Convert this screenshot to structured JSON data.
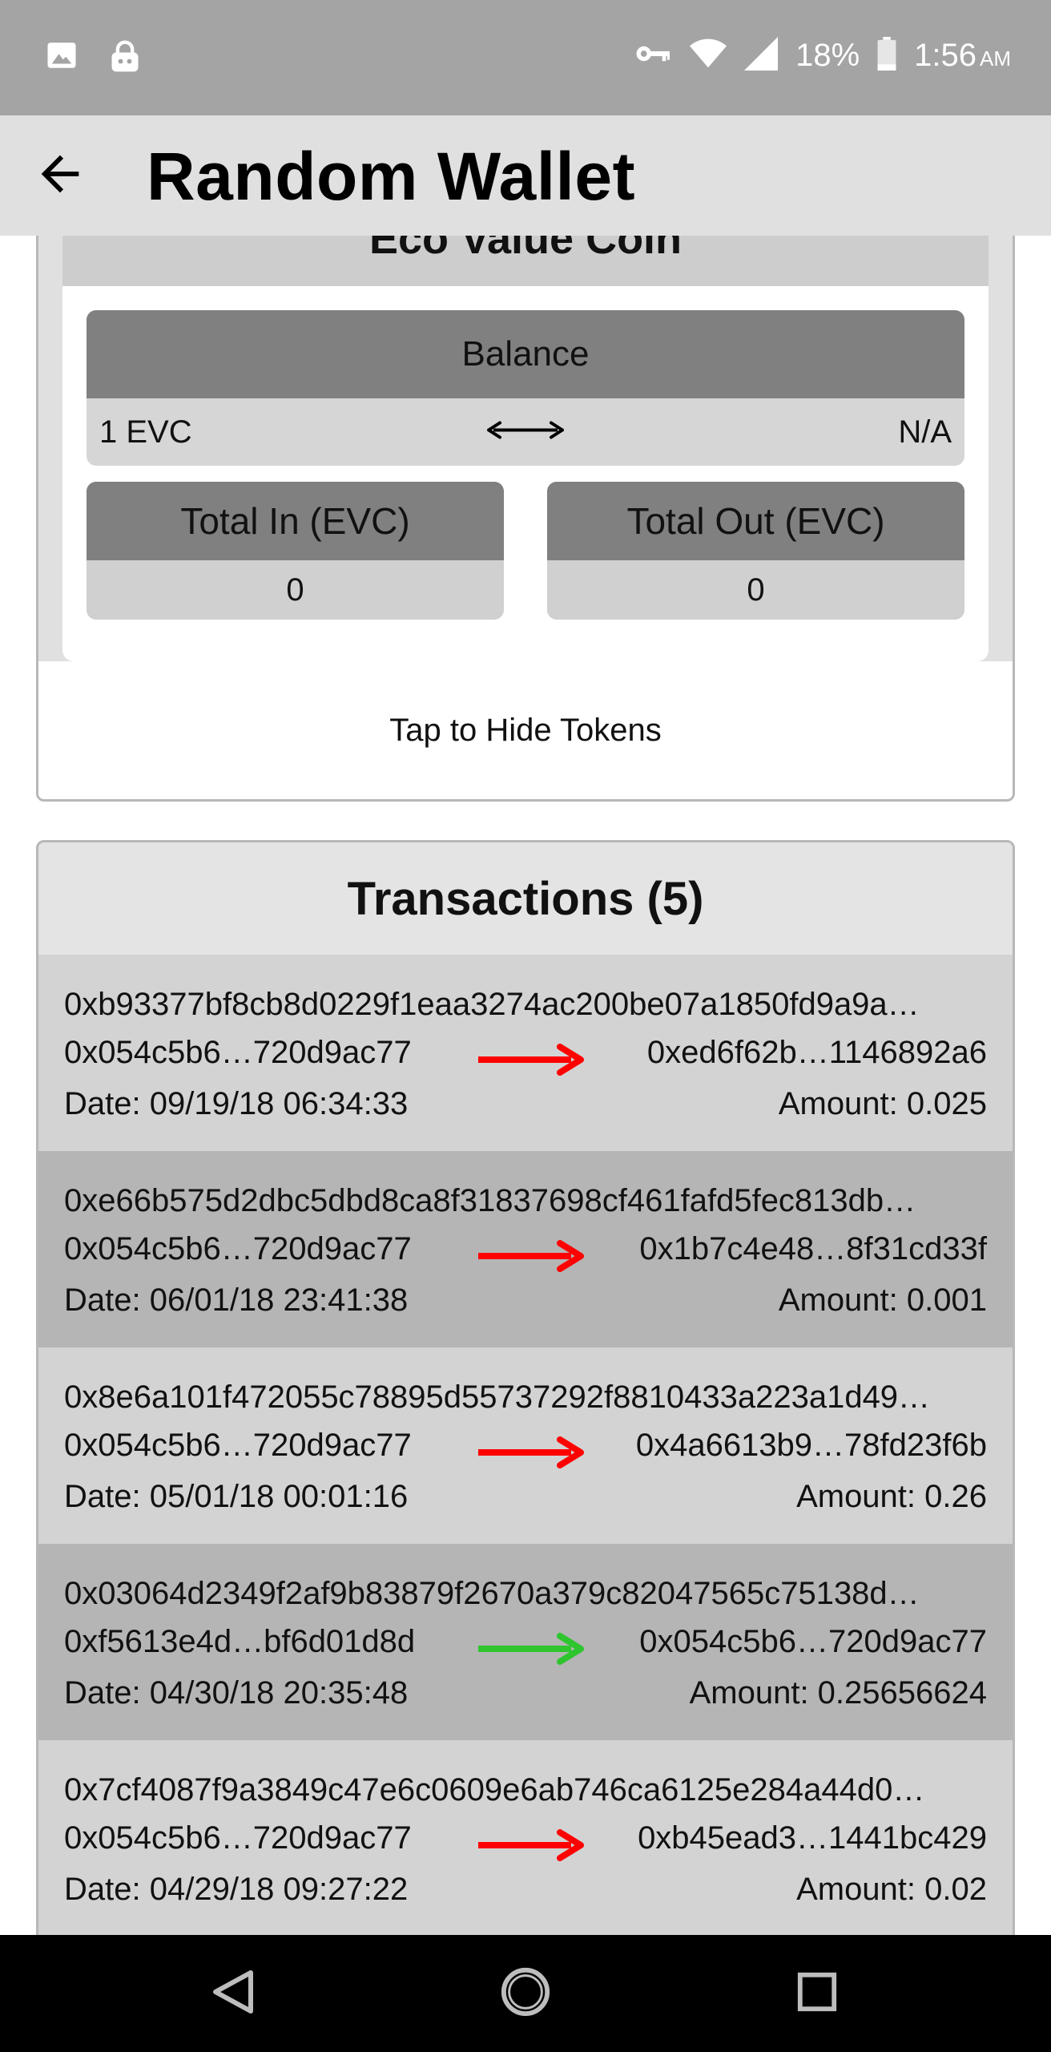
{
  "status_bar": {
    "battery": "18%",
    "time": "1:56",
    "ampm": "AM",
    "icons": [
      "image-icon",
      "vpn-lock-icon",
      "key-icon",
      "wifi-icon",
      "signal-icon",
      "battery-icon"
    ]
  },
  "app_bar": {
    "title": "Random Wallet",
    "back_icon": "arrow-back-icon"
  },
  "token": {
    "name": "Eco Value Coin",
    "balance_label": "Balance",
    "balance_value": "1 EVC",
    "balance_fiat": "N/A",
    "total_in_label": "Total In (EVC)",
    "total_in_value": "0",
    "total_out_label": "Total Out (EVC)",
    "total_out_value": "0",
    "hide_label": "Tap to Hide Tokens"
  },
  "transactions": {
    "header": "Transactions (5)",
    "items": [
      {
        "hash": "0xb93377bf8cb8d0229f1eaa3274ac200be07a1850fd9a9a…",
        "from": "0x054c5b6…720d9ac77",
        "to": "0xed6f62b…1146892a6",
        "date": "Date: 09/19/18 06:34:33",
        "amount": "Amount: 0.025",
        "direction": "out"
      },
      {
        "hash": "0xe66b575d2dbc5dbd8ca8f31837698cf461fafd5fec813db…",
        "from": "0x054c5b6…720d9ac77",
        "to": "0x1b7c4e48…8f31cd33f",
        "date": "Date: 06/01/18 23:41:38",
        "amount": "Amount: 0.001",
        "direction": "out"
      },
      {
        "hash": "0x8e6a101f472055c78895d55737292f8810433a223a1d49…",
        "from": "0x054c5b6…720d9ac77",
        "to": "0x4a6613b9…78fd23f6b",
        "date": "Date: 05/01/18 00:01:16",
        "amount": "Amount: 0.26",
        "direction": "out"
      },
      {
        "hash": "0x03064d2349f2af9b83879f2670a379c82047565c75138d…",
        "from": "0xf5613e4d…bf6d01d8d",
        "to": "0x054c5b6…720d9ac77",
        "date": "Date: 04/30/18 20:35:48",
        "amount": "Amount: 0.25656624",
        "direction": "in"
      },
      {
        "hash": "0x7cf4087f9a3849c47e6c0609e6ab746ca6125e284a44d0…",
        "from": "0x054c5b6…720d9ac77",
        "to": "0xb45ead3…1441bc429",
        "date": "Date: 04/29/18 09:27:22",
        "amount": "Amount: 0.02",
        "direction": "out"
      }
    ]
  },
  "colors": {
    "out_arrow": "#ff0000",
    "in_arrow": "#2ec52e",
    "status_bar": "#a4a4a4",
    "app_bar": "#e0e0e0"
  },
  "nav_bar": {
    "icons": [
      "back-triangle-icon",
      "home-circle-icon",
      "recents-square-icon"
    ]
  }
}
